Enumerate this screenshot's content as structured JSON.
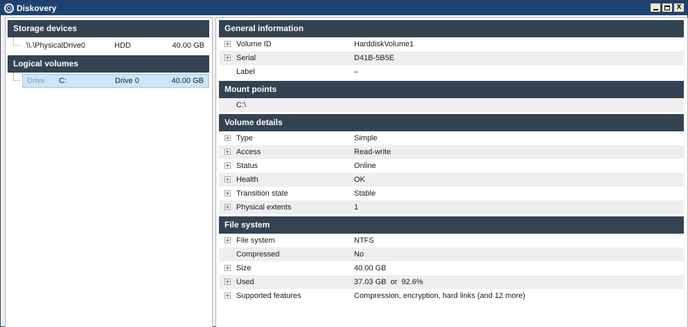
{
  "window": {
    "title": "Diskovery",
    "controls": {
      "minimize": "_",
      "maximize": "□",
      "close": "X"
    }
  },
  "left": {
    "storage": {
      "header": "Storage devices",
      "items": [
        {
          "path": "\\\\.\\PhysicalDrive0",
          "type": "HDD",
          "size": "40.00 GB"
        }
      ]
    },
    "logical": {
      "header": "Logical volumes",
      "items": [
        {
          "kind": "Drive",
          "letter": "C:",
          "drive": "Drive 0",
          "size": "40.00 GB",
          "selected": true
        }
      ]
    }
  },
  "right": {
    "general": {
      "header": "General information",
      "rows": [
        {
          "name": "Volume ID",
          "value": "HarddiskVolume1",
          "expandable": true
        },
        {
          "name": "Serial",
          "value": "D41B-5B5E",
          "expandable": true
        },
        {
          "name": "Label",
          "value": "–",
          "expandable": false
        }
      ]
    },
    "mount": {
      "header": "Mount points",
      "rows": [
        {
          "value": "C:\\"
        }
      ]
    },
    "volume": {
      "header": "Volume details",
      "rows": [
        {
          "name": "Type",
          "value": "Simple",
          "expandable": true
        },
        {
          "name": "Access",
          "value": "Read-write",
          "expandable": true
        },
        {
          "name": "Status",
          "value": "Online",
          "expandable": true
        },
        {
          "name": "Health",
          "value": "OK",
          "expandable": true
        },
        {
          "name": "Transition state",
          "value": "Stable",
          "expandable": true
        },
        {
          "name": "Physical extents",
          "value": "1",
          "expandable": true
        }
      ]
    },
    "filesystem": {
      "header": "File system",
      "rows": [
        {
          "name": "File system",
          "value": "NTFS",
          "expandable": true
        },
        {
          "name": "Compressed",
          "value": "No",
          "expandable": false
        },
        {
          "name": "Size",
          "value": "40.00 GB",
          "expandable": true
        },
        {
          "name": "Used",
          "value": "37.03 GB  or  92.6%",
          "expandable": true
        },
        {
          "name": "Supported features",
          "value": "Compression, encryption, hard links (and 12 more)",
          "expandable": true
        }
      ]
    }
  },
  "colors": {
    "titlebar": "#1d4274",
    "section_header": "#344352",
    "selection": "#cce6f8",
    "alt_row": "#eeeeee"
  }
}
